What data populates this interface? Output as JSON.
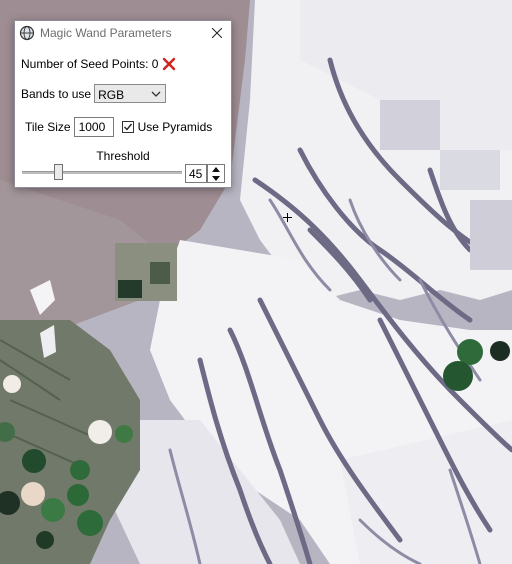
{
  "dialog": {
    "title": "Magic Wand Parameters",
    "seed_points_label": "Number of Seed Points: 0",
    "bands_label": "Bands to use",
    "bands_value": "RGB",
    "tile_size_label": "Tile Size",
    "tile_size_value": "1000",
    "use_pyramids_label": "Use Pyramids",
    "use_pyramids_checked": true,
    "threshold_label": "Threshold",
    "threshold_value": "45",
    "threshold_fraction": 0.2
  },
  "colors": {
    "clear_x": "#d0201f",
    "map_background": "#b9b6c2",
    "snow": "#f4f4f6",
    "channel": "#6d6a86",
    "green_field": "#2e6b3a"
  }
}
